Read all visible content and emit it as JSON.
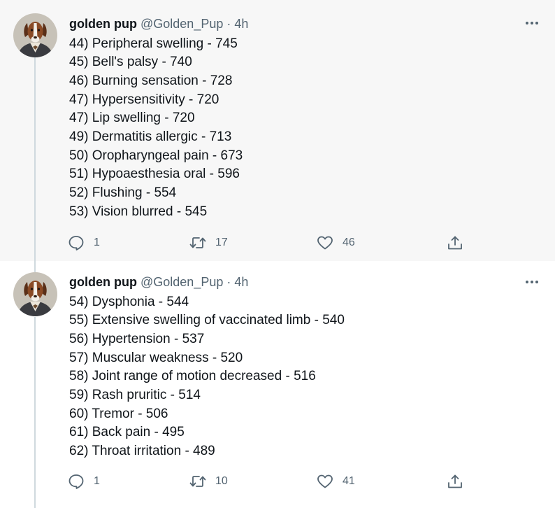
{
  "colors": {
    "text_primary": "#0f1419",
    "text_secondary": "#536471",
    "thread_line": "#cfd9de",
    "tweet1_background": "#f7f7f7"
  },
  "tweets": [
    {
      "author_name": "golden pup",
      "handle": "@Golden_Pup",
      "separator": "·",
      "time": "4h",
      "avatar_icon": "dog-portrait-avatar",
      "lines": [
        "44) Peripheral swelling - 745",
        "45) Bell's palsy - 740",
        "46) Burning sensation - 728",
        "47) Hypersensitivity - 720",
        "47) Lip swelling - 720",
        "49) Dermatitis allergic - 713",
        "50) Oropharyngeal pain - 673",
        "51) Hypoaesthesia oral - 596",
        "52) Flushing - 554",
        "53) Vision blurred - 545"
      ],
      "reply_count": "1",
      "retweet_count": "17",
      "like_count": "46"
    },
    {
      "author_name": "golden pup",
      "handle": "@Golden_Pup",
      "separator": "·",
      "time": "4h",
      "avatar_icon": "dog-portrait-avatar",
      "lines": [
        "54) Dysphonia - 544",
        "55) Extensive swelling of vaccinated limb - 540",
        "56) Hypertension - 537",
        "57) Muscular weakness - 520",
        "58) Joint range of motion decreased - 516",
        "59) Rash pruritic - 514",
        "60) Tremor - 506",
        "61) Back pain - 495",
        "62) Throat irritation - 489"
      ],
      "reply_count": "1",
      "retweet_count": "10",
      "like_count": "41"
    }
  ]
}
